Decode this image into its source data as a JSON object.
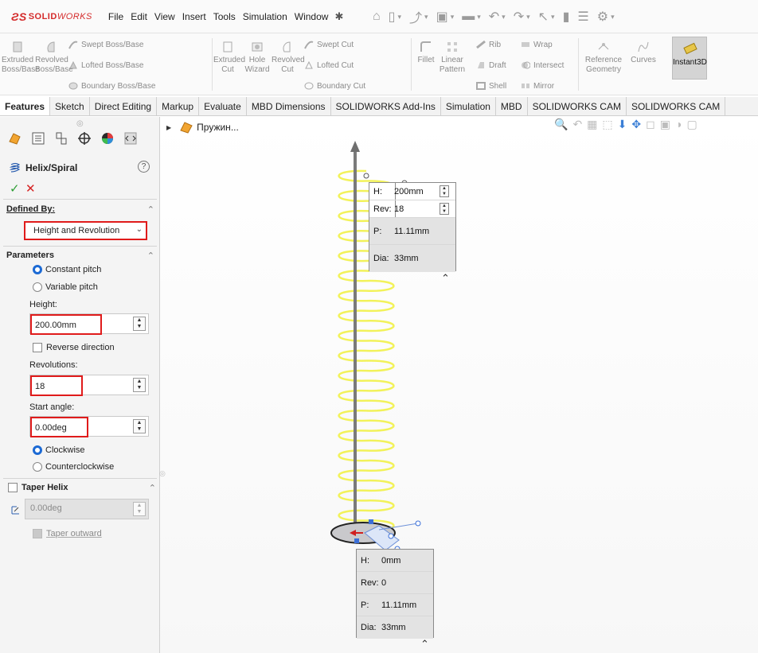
{
  "app": {
    "logo_ds": "ƧS",
    "logo_solid": "SOLID",
    "logo_works": "WORKS"
  },
  "menu": [
    "File",
    "Edit",
    "View",
    "Insert",
    "Tools",
    "Simulation",
    "Window"
  ],
  "ribbon": {
    "extruded_boss": [
      "Extruded",
      "Boss/Base"
    ],
    "revolved_boss": [
      "Revolved",
      "Boss/Base"
    ],
    "swept_boss": "Swept Boss/Base",
    "lofted_boss": "Lofted Boss/Base",
    "boundary_boss": "Boundary Boss/Base",
    "extruded_cut": [
      "Extruded",
      "Cut"
    ],
    "hole_wizard": [
      "Hole",
      "Wizard"
    ],
    "revolved_cut": [
      "Revolved",
      "Cut"
    ],
    "swept_cut": "Swept Cut",
    "lofted_cut": "Lofted Cut",
    "boundary_cut": "Boundary Cut",
    "fillet": "Fillet",
    "linear_pattern": [
      "Linear",
      "Pattern"
    ],
    "rib": "Rib",
    "wrap": "Wrap",
    "draft": "Draft",
    "intersect": "Intersect",
    "shell": "Shell",
    "mirror": "Mirror",
    "reference_geometry": [
      "Reference",
      "Geometry"
    ],
    "curves": "Curves",
    "instant3d": "Instant3D"
  },
  "tabs": [
    "Features",
    "Sketch",
    "Direct Editing",
    "Markup",
    "Evaluate",
    "MBD Dimensions",
    "SOLIDWORKS Add-Ins",
    "Simulation",
    "MBD",
    "SOLIDWORKS CAM",
    "SOLIDWORKS CAM"
  ],
  "pm": {
    "title": "Helix/Spiral",
    "help": "?",
    "ok": "✓",
    "cancel": "✕",
    "defined_by_label": "Defined By:",
    "defined_by_value": "Height and Revolution",
    "parameters_label": "Parameters",
    "constant_pitch": "Constant pitch",
    "variable_pitch": "Variable pitch",
    "height_label": "Height:",
    "height_value": "200.00mm",
    "reverse_direction": "Reverse direction",
    "revolutions_label": "Revolutions:",
    "revolutions_value": "18",
    "start_angle_label": "Start angle:",
    "start_angle_value": "0.00deg",
    "clockwise": "Clockwise",
    "counterclockwise": "Counterclockwise",
    "taper_helix": "Taper Helix",
    "taper_angle": "0.00deg",
    "taper_outward": "Taper outward"
  },
  "tree": {
    "part_name": "Пружин..."
  },
  "callout_top": {
    "h_key": "H:",
    "h_val": "200mm",
    "rev_key": "Rev:",
    "rev_val": "18",
    "p_key": "P:",
    "p_val": "11.11mm",
    "dia_key": "Dia:",
    "dia_val": "33mm"
  },
  "callout_bottom": {
    "h_key": "H:",
    "h_val": "0mm",
    "rev_key": "Rev:",
    "rev_val": "0",
    "p_key": "P:",
    "p_val": "11.11mm",
    "dia_key": "Dia:",
    "dia_val": "33mm"
  },
  "helix": {
    "revolutions": 18,
    "color": "#f2f25a",
    "axis_color": "#7a7a7a"
  },
  "colors": {
    "accent_red": "#e01b1b",
    "radio_blue": "#1c6ad4",
    "ok_green": "#2e9e35"
  }
}
